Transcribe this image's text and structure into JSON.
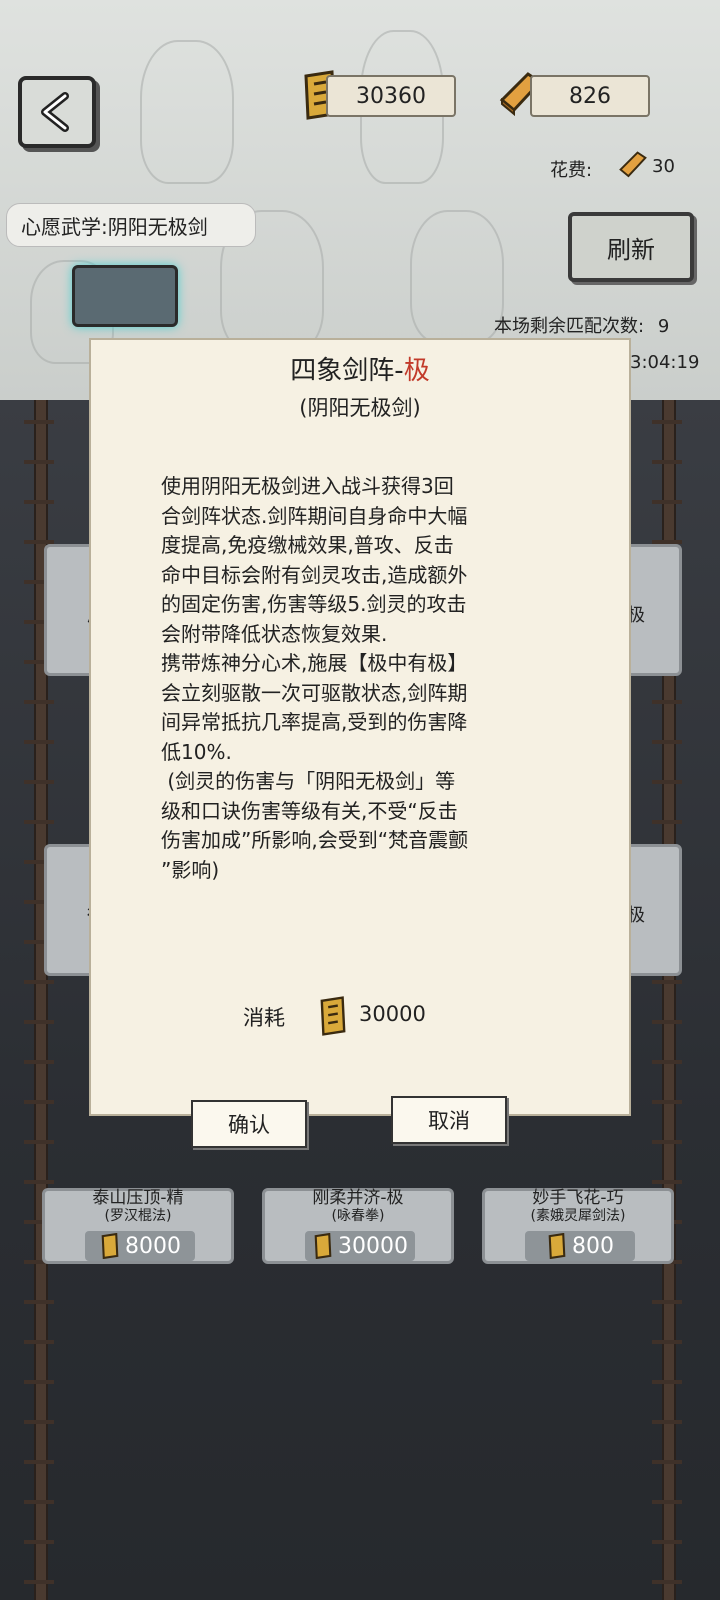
{
  "header": {
    "currency_primary": "30360",
    "currency_secondary": "826",
    "cost_label": "花费:",
    "cost_value": "30",
    "wish_label": "心愿武学:阴阳无极剑",
    "refresh_label": "刷新",
    "remaining_label": "本场剩余匹配次数:",
    "remaining_value": "9",
    "timer": "3:04:19"
  },
  "cards": [
    {
      "name": "泰山压顶-精",
      "sub": "(罗汉棍法)",
      "price": "8000"
    },
    {
      "name": "刚柔并济-极",
      "sub": "(咏春拳)",
      "price": "30000"
    },
    {
      "name": "妙手飞花-巧",
      "sub": "(素娥灵犀剑法)",
      "price": "800"
    }
  ],
  "side_glimpses": [
    "广",
    "极",
    "得",
    "极"
  ],
  "modal": {
    "title_main": "四象剑阵-",
    "title_grade": "极",
    "subtitle": "(阴阳无极剑)",
    "description": "使用阴阳无极剑进入战斗获得3回\n合剑阵状态.剑阵期间自身命中大幅\n度提高,免疫缴械效果,普攻、反击\n命中目标会附有剑灵攻击,造成额外\n的固定伤害,伤害等级5.剑灵的攻击\n会附带降低状态恢复效果.\n携带炼神分心术,施展【极中有极】\n会立刻驱散一次可驱散状态,剑阵期\n间异常抵抗几率提高,受到的伤害降\n低10%.\n (剑灵的伤害与「阴阳无极剑」等\n级和口诀伤害等级有关,不受“反击\n伤害加成”所影响,会受到“梵音震颤\n”影响)",
    "cost_label": "消耗",
    "cost_value": "30000",
    "confirm_label": "确认",
    "cancel_label": "取消"
  },
  "colors": {
    "grade_red": "#c23a2a",
    "parchment": "#f6f1e3",
    "scroll_gold": "#d9a93a"
  }
}
